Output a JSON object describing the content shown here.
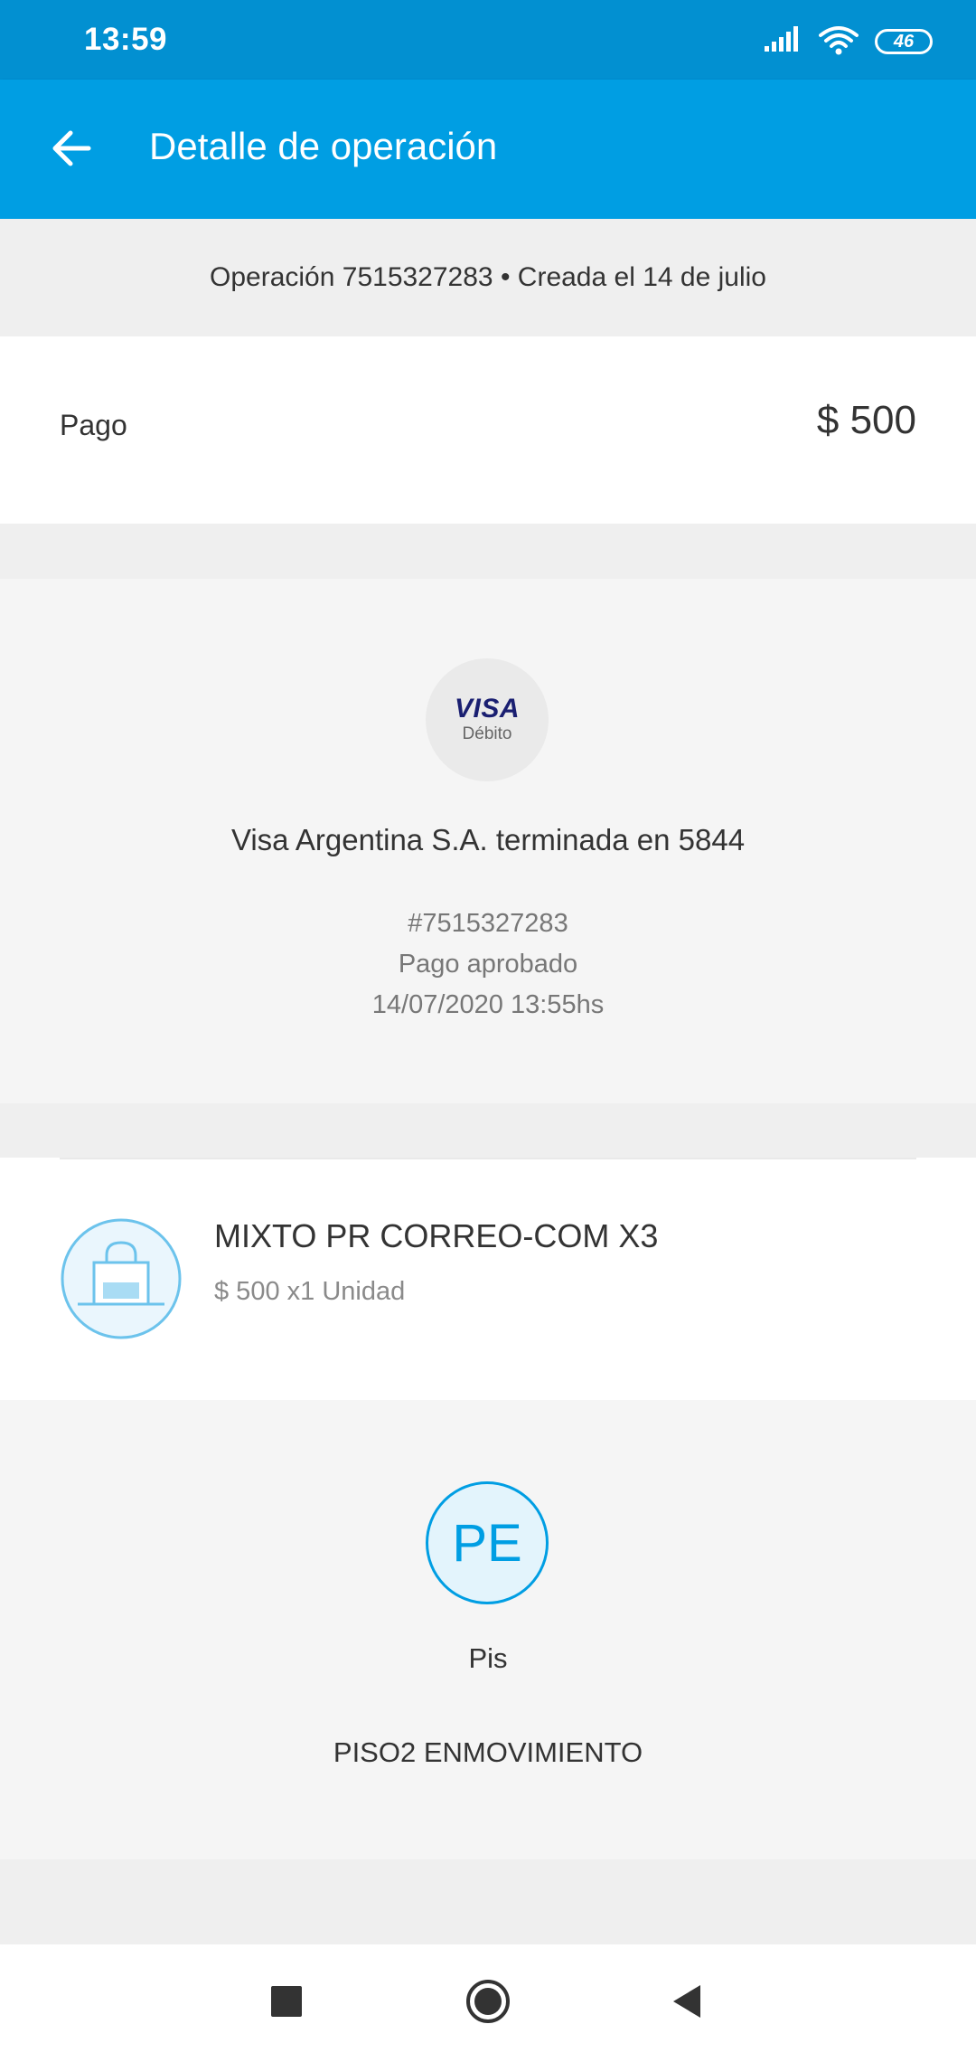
{
  "status_bar": {
    "time": "13:59",
    "battery": "46",
    "icons": [
      "signal-icon",
      "wifi-icon",
      "battery-icon"
    ]
  },
  "header": {
    "title": "Detalle de operación",
    "back_icon": "arrow-left-icon"
  },
  "operation": {
    "summary": "Operación 7515327283 • Creada el 14 de julio"
  },
  "payment": {
    "label": "Pago",
    "amount": "$ 500"
  },
  "card": {
    "brand": "VISA",
    "type": "Débito",
    "name": "Visa Argentina S.A. terminada en 5844",
    "number": "#7515327283",
    "status": "Pago aprobado",
    "datetime": "14/07/2020 13:55hs"
  },
  "item": {
    "icon": "shopping-bag-icon",
    "title": "MIXTO PR CORREO-COM X3",
    "detail": "$ 500 x1 Unidad"
  },
  "seller": {
    "initials": "PE",
    "name": "Pis",
    "description": "PISO2 ENMOVIMIENTO"
  },
  "navigation": {
    "buttons": [
      "recents-icon",
      "home-icon",
      "back-triangle-icon"
    ]
  },
  "colors": {
    "status_bar": "#0290d1",
    "app_bar": "#009ee3",
    "accent": "#009ee3",
    "visa_blue": "#1a1f71",
    "background": "#efefef"
  }
}
